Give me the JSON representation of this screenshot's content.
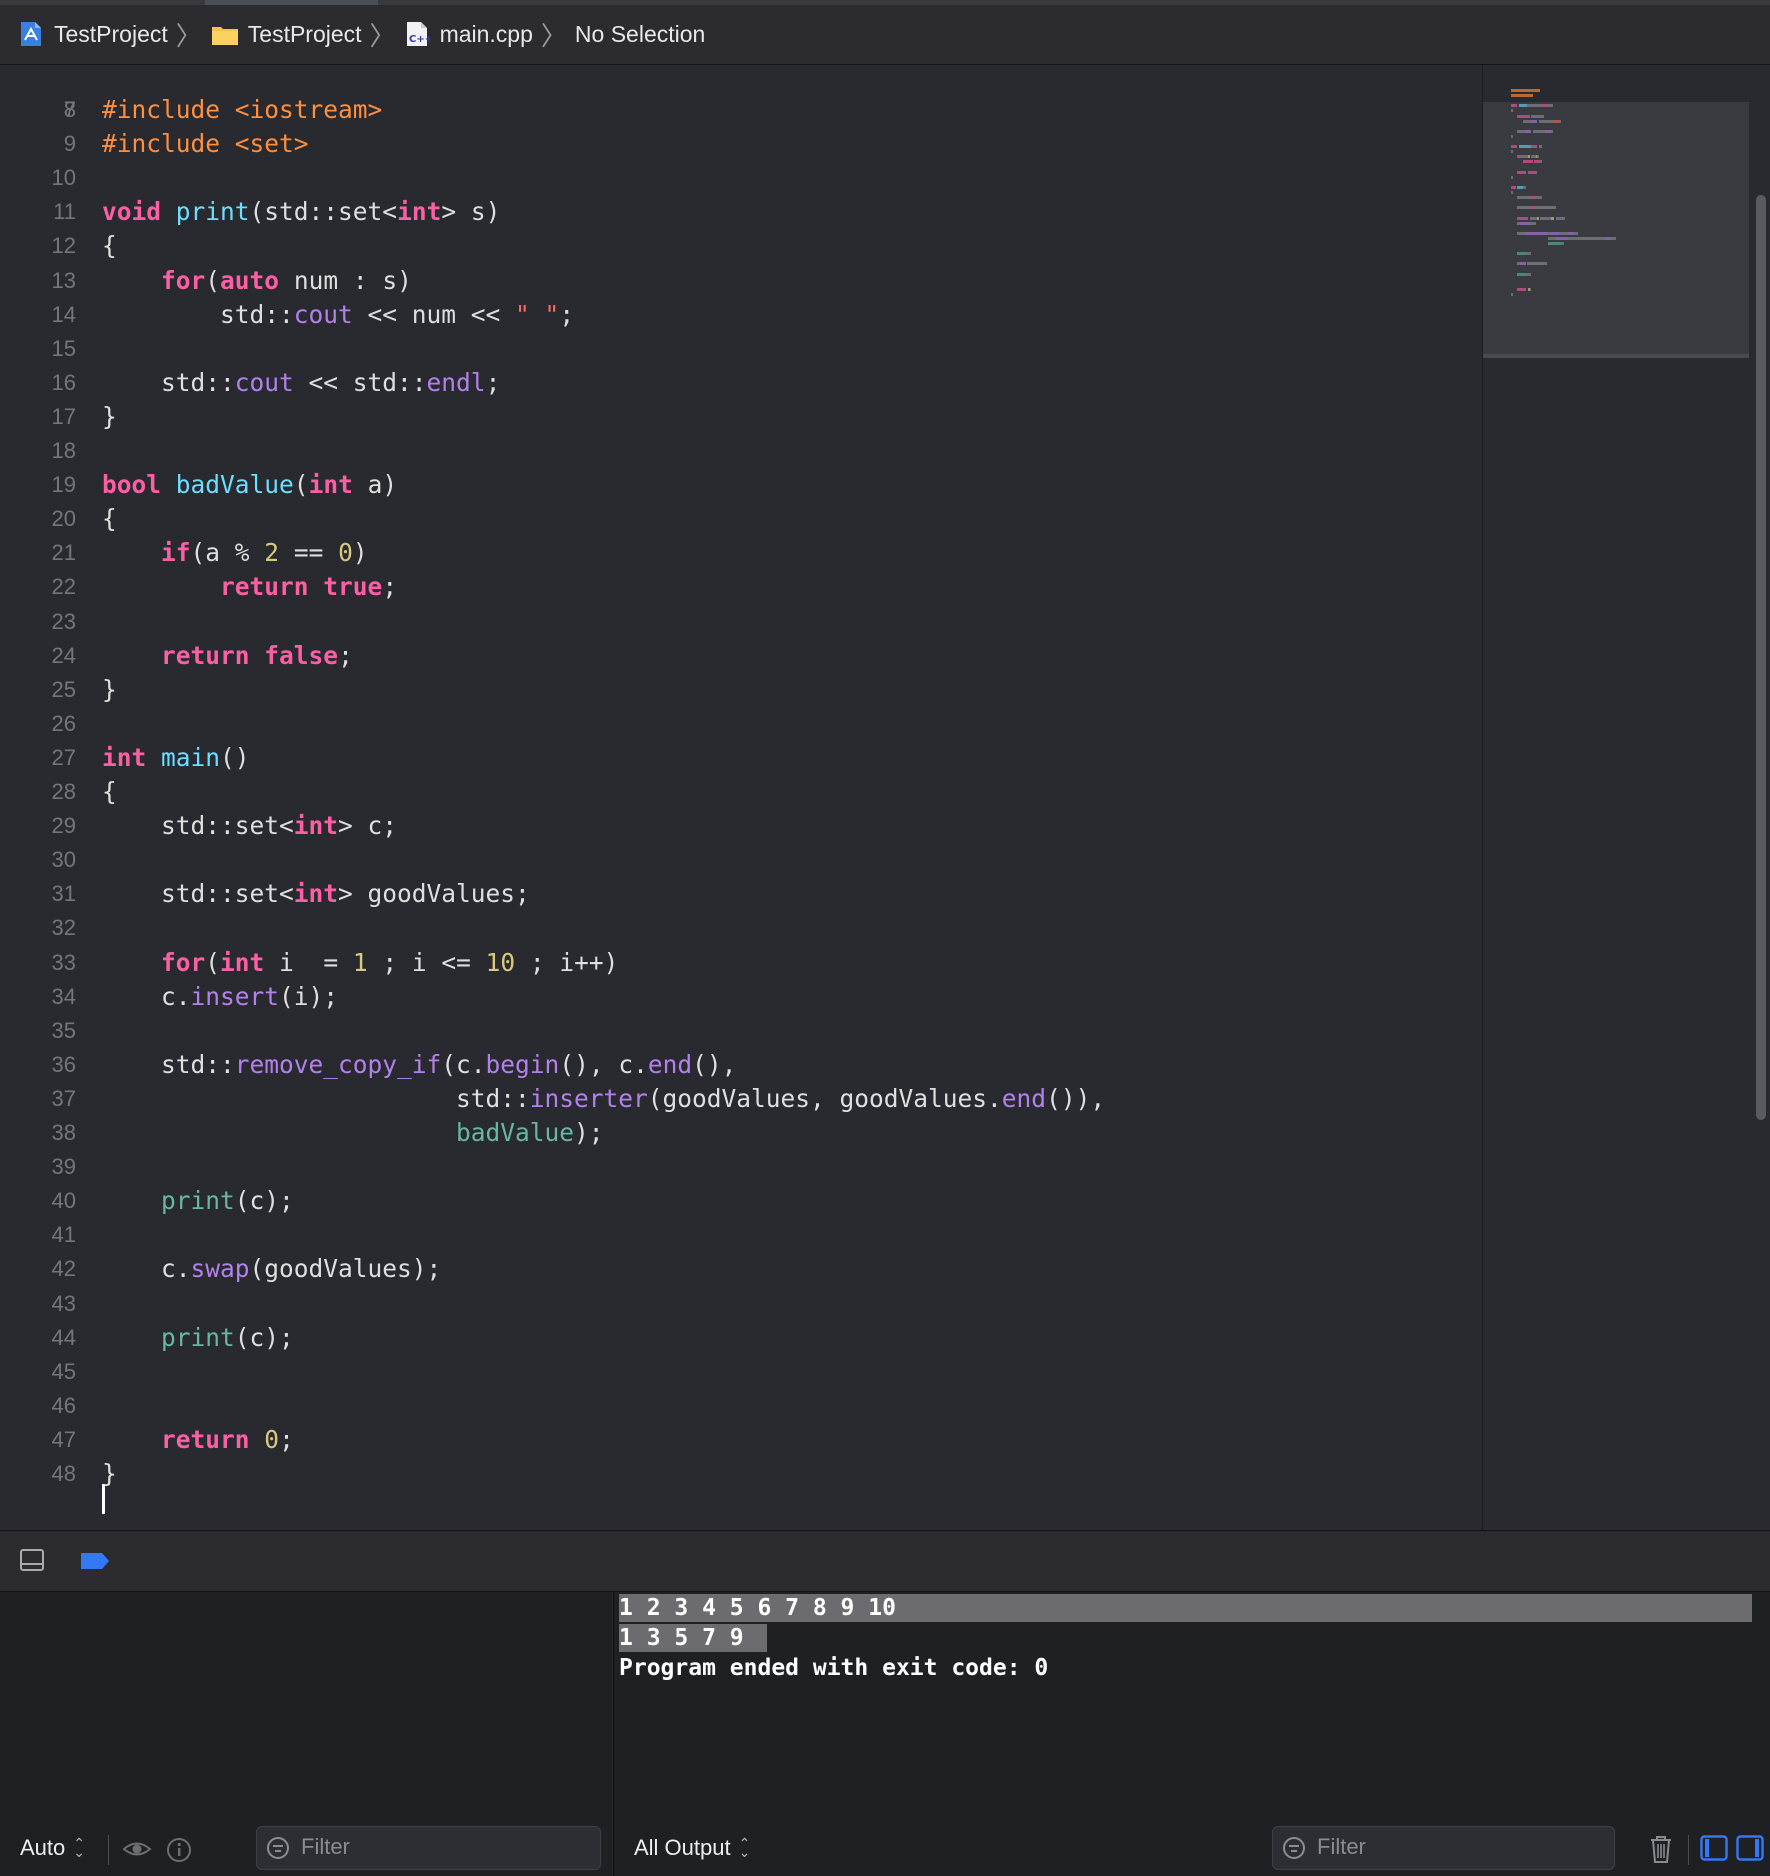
{
  "breadcrumb": {
    "project": "TestProject",
    "folder": "TestProject",
    "file": "main.cpp",
    "selection": "No Selection"
  },
  "editor": {
    "first_line": "7",
    "current_line": "49",
    "lines": [
      {
        "n": "8",
        "tokens": [
          [
            "pp",
            "#include <iostream>"
          ]
        ]
      },
      {
        "n": "9",
        "tokens": [
          [
            "pp",
            "#include <set>"
          ]
        ]
      },
      {
        "n": "10",
        "tokens": []
      },
      {
        "n": "11",
        "tokens": [
          [
            "kw",
            "void"
          ],
          [
            "plain",
            " "
          ],
          [
            "fn",
            "print"
          ],
          [
            "plain",
            "(std::set<"
          ],
          [
            "kw",
            "int"
          ],
          [
            "plain",
            "> s)"
          ]
        ]
      },
      {
        "n": "12",
        "tokens": [
          [
            "plain",
            "{"
          ]
        ]
      },
      {
        "n": "13",
        "tokens": [
          [
            "plain",
            "    "
          ],
          [
            "kw",
            "for"
          ],
          [
            "plain",
            "("
          ],
          [
            "kw",
            "auto"
          ],
          [
            "plain",
            " num : s)"
          ]
        ]
      },
      {
        "n": "14",
        "tokens": [
          [
            "plain",
            "        std::"
          ],
          [
            "libm",
            "cout"
          ],
          [
            "plain",
            " << num << "
          ],
          [
            "str",
            "\" \""
          ],
          [
            "plain",
            ";"
          ]
        ]
      },
      {
        "n": "15",
        "tokens": []
      },
      {
        "n": "16",
        "tokens": [
          [
            "plain",
            "    std::"
          ],
          [
            "libm",
            "cout"
          ],
          [
            "plain",
            " << std::"
          ],
          [
            "libm",
            "endl"
          ],
          [
            "plain",
            ";"
          ]
        ]
      },
      {
        "n": "17",
        "tokens": [
          [
            "plain",
            "}"
          ]
        ]
      },
      {
        "n": "18",
        "tokens": []
      },
      {
        "n": "19",
        "tokens": [
          [
            "kw",
            "bool"
          ],
          [
            "plain",
            " "
          ],
          [
            "fn",
            "badValue"
          ],
          [
            "plain",
            "("
          ],
          [
            "kw",
            "int"
          ],
          [
            "plain",
            " a)"
          ]
        ]
      },
      {
        "n": "20",
        "tokens": [
          [
            "plain",
            "{"
          ]
        ]
      },
      {
        "n": "21",
        "tokens": [
          [
            "plain",
            "    "
          ],
          [
            "kw",
            "if"
          ],
          [
            "plain",
            "(a % "
          ],
          [
            "num",
            "2"
          ],
          [
            "plain",
            " == "
          ],
          [
            "num",
            "0"
          ],
          [
            "plain",
            ")"
          ]
        ]
      },
      {
        "n": "22",
        "tokens": [
          [
            "plain",
            "        "
          ],
          [
            "kw",
            "return"
          ],
          [
            "plain",
            " "
          ],
          [
            "kw",
            "true"
          ],
          [
            "plain",
            ";"
          ]
        ]
      },
      {
        "n": "23",
        "tokens": []
      },
      {
        "n": "24",
        "tokens": [
          [
            "plain",
            "    "
          ],
          [
            "kw",
            "return"
          ],
          [
            "plain",
            " "
          ],
          [
            "kw",
            "false"
          ],
          [
            "plain",
            ";"
          ]
        ]
      },
      {
        "n": "25",
        "tokens": [
          [
            "plain",
            "}"
          ]
        ]
      },
      {
        "n": "26",
        "tokens": []
      },
      {
        "n": "27",
        "tokens": [
          [
            "kw",
            "int"
          ],
          [
            "plain",
            " "
          ],
          [
            "fn",
            "main"
          ],
          [
            "plain",
            "()"
          ]
        ]
      },
      {
        "n": "28",
        "tokens": [
          [
            "plain",
            "{"
          ]
        ]
      },
      {
        "n": "29",
        "tokens": [
          [
            "plain",
            "    std::set<"
          ],
          [
            "kw",
            "int"
          ],
          [
            "plain",
            "> c;"
          ]
        ]
      },
      {
        "n": "30",
        "tokens": []
      },
      {
        "n": "31",
        "tokens": [
          [
            "plain",
            "    std::set<"
          ],
          [
            "kw",
            "int"
          ],
          [
            "plain",
            "> goodValues;"
          ]
        ]
      },
      {
        "n": "32",
        "tokens": []
      },
      {
        "n": "33",
        "tokens": [
          [
            "plain",
            "    "
          ],
          [
            "kw",
            "for"
          ],
          [
            "plain",
            "("
          ],
          [
            "kw",
            "int"
          ],
          [
            "plain",
            " i  = "
          ],
          [
            "num",
            "1"
          ],
          [
            "plain",
            " ; i <= "
          ],
          [
            "num",
            "10"
          ],
          [
            "plain",
            " ; i++)"
          ]
        ]
      },
      {
        "n": "34",
        "tokens": [
          [
            "plain",
            "    c."
          ],
          [
            "libm",
            "insert"
          ],
          [
            "plain",
            "(i);"
          ]
        ]
      },
      {
        "n": "35",
        "tokens": []
      },
      {
        "n": "36",
        "tokens": [
          [
            "plain",
            "    std::"
          ],
          [
            "libm",
            "remove_copy_if"
          ],
          [
            "plain",
            "(c."
          ],
          [
            "libm",
            "begin"
          ],
          [
            "plain",
            "(), c."
          ],
          [
            "libm",
            "end"
          ],
          [
            "plain",
            "(),"
          ]
        ]
      },
      {
        "n": "37",
        "tokens": [
          [
            "plain",
            "                        std::"
          ],
          [
            "libm",
            "inserter"
          ],
          [
            "plain",
            "(goodValues, goodValues."
          ],
          [
            "libm",
            "end"
          ],
          [
            "plain",
            "()),"
          ]
        ]
      },
      {
        "n": "38",
        "tokens": [
          [
            "plain",
            "                        "
          ],
          [
            "fn2",
            "badValue"
          ],
          [
            "plain",
            ");"
          ]
        ]
      },
      {
        "n": "39",
        "tokens": []
      },
      {
        "n": "40",
        "tokens": [
          [
            "plain",
            "    "
          ],
          [
            "fn2",
            "print"
          ],
          [
            "plain",
            "(c);"
          ]
        ]
      },
      {
        "n": "41",
        "tokens": []
      },
      {
        "n": "42",
        "tokens": [
          [
            "plain",
            "    c."
          ],
          [
            "libm",
            "swap"
          ],
          [
            "plain",
            "(goodValues);"
          ]
        ]
      },
      {
        "n": "43",
        "tokens": []
      },
      {
        "n": "44",
        "tokens": [
          [
            "plain",
            "    "
          ],
          [
            "fn2",
            "print"
          ],
          [
            "plain",
            "(c);"
          ]
        ]
      },
      {
        "n": "45",
        "tokens": []
      },
      {
        "n": "46",
        "tokens": []
      },
      {
        "n": "47",
        "tokens": [
          [
            "plain",
            "    "
          ],
          [
            "kw",
            "return"
          ],
          [
            "plain",
            " "
          ],
          [
            "num",
            "0"
          ],
          [
            "plain",
            ";"
          ]
        ]
      },
      {
        "n": "48",
        "tokens": [
          [
            "plain",
            "}"
          ]
        ]
      }
    ]
  },
  "console": {
    "output": [
      "1 2 3 4 5 6 7 8 9 10",
      "1 3 5 7 9",
      "Program ended with exit code: 0"
    ]
  },
  "bottom_bar": {
    "variables_scope": "Auto",
    "variables_filter_placeholder": "Filter",
    "output_scope": "All Output",
    "console_filter_placeholder": "Filter"
  },
  "icons": {
    "project": "xcode-project-icon",
    "folder": "folder-icon",
    "file": "cpp-file-icon",
    "panel_toggle": "debug-area-toggle-icon",
    "breakpoints": "breakpoints-icon",
    "eye": "eye-icon",
    "info": "info-icon",
    "trash": "trash-icon"
  },
  "colors": {
    "background": "#292a30",
    "keyword": "#fc5fa3",
    "preprocessor": "#fd8f3f",
    "function_decl": "#6bdfff",
    "function_call": "#67b7a4",
    "library": "#b281eb",
    "number": "#d9c97c",
    "string": "#fc6a5d",
    "accent": "#3478f6"
  }
}
